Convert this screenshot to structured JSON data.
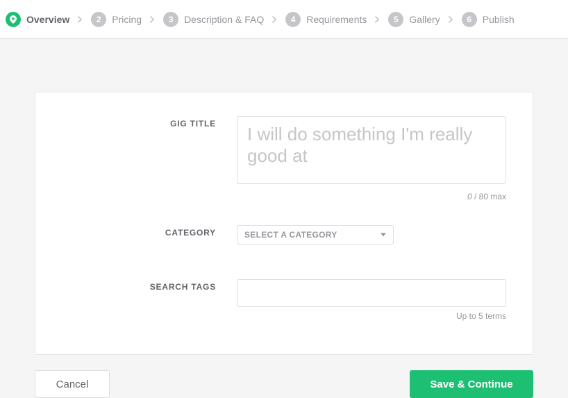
{
  "steps": [
    {
      "label": "Overview",
      "num": ""
    },
    {
      "label": "Pricing",
      "num": "2"
    },
    {
      "label": "Description & FAQ",
      "num": "3"
    },
    {
      "label": "Requirements",
      "num": "4"
    },
    {
      "label": "Gallery",
      "num": "5"
    },
    {
      "label": "Publish",
      "num": "6"
    }
  ],
  "labels": {
    "gig_title": "GIG TITLE",
    "category": "CATEGORY",
    "search_tags": "SEARCH TAGS"
  },
  "gig_title": {
    "placeholder": "I will do something I'm really good at",
    "value": "",
    "count": "0",
    "max_text": " / 80 max"
  },
  "category": {
    "placeholder": "SELECT A CATEGORY"
  },
  "search_tags": {
    "helper": "Up to 5 terms"
  },
  "buttons": {
    "cancel": "Cancel",
    "save": "Save & Continue"
  }
}
